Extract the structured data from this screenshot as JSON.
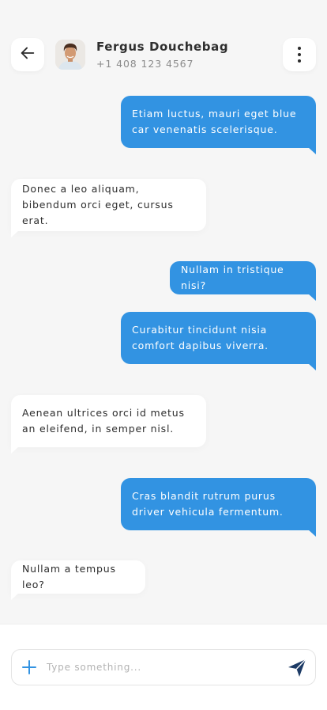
{
  "contact": {
    "name": "Fergus Douchebag",
    "phone": "+1 408 123 4567"
  },
  "icons": {
    "back": "arrow-left-icon",
    "menu": "more-vertical-icon",
    "attach": "plus-icon",
    "send": "send-icon"
  },
  "colors": {
    "outgoing_bubble": "#3293e2",
    "incoming_bubble": "#ffffff",
    "background": "#f6f6f6",
    "send_icon": "#1d3b66",
    "plus_icon": "#3293e2"
  },
  "messages": [
    {
      "direction": "outgoing",
      "text": "Etiam luctus, mauri eget blue car venenatis scelerisque."
    },
    {
      "direction": "incoming",
      "text": "Donec a leo aliquam, bibendum orci eget, cursus erat."
    },
    {
      "direction": "outgoing",
      "text": "Nullam in tristique nisi?"
    },
    {
      "direction": "outgoing",
      "text": "Curabitur tincidunt nisia comfort dapibus viverra."
    },
    {
      "direction": "incoming",
      "text": "Aenean ultrices orci id metus an eleifend, in semper nisl."
    },
    {
      "direction": "outgoing",
      "text": "Cras blandit rutrum purus driver vehicula fermentum."
    },
    {
      "direction": "incoming",
      "text": "Nullam a tempus leo?"
    }
  ],
  "composer": {
    "placeholder": "Type something..."
  }
}
